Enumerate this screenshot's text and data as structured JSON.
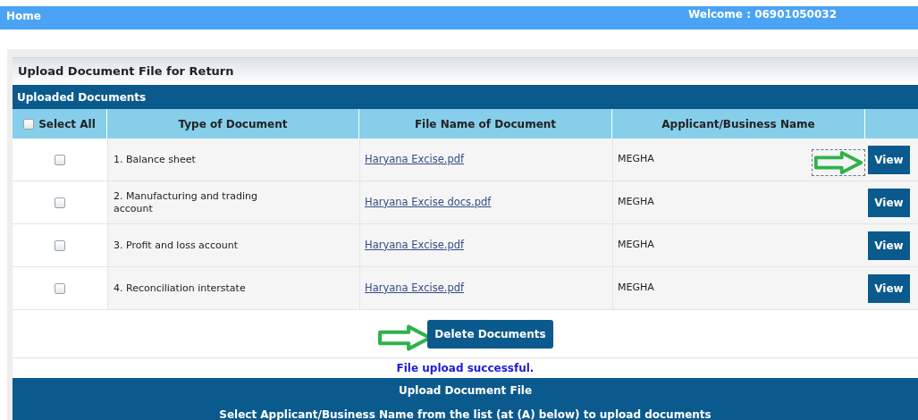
{
  "top_bar": {
    "home": "Home",
    "welcome": "Welcome : 06901050032"
  },
  "panel": {
    "title": "Upload Document File for Return",
    "section": "Uploaded Documents"
  },
  "table": {
    "select_all": {
      "label": "Select All",
      "checked": false
    },
    "columns": [
      "Type of Document",
      "File Name of Document",
      "Applicant/Business Name"
    ],
    "rows": [
      {
        "checked": false,
        "type": "1. Balance sheet",
        "file": "Haryana Excise.pdf",
        "applicant": "MEGHA",
        "action": "View",
        "annotated": true
      },
      {
        "checked": false,
        "type": "2. Manufacturing and trading account",
        "file": "Haryana Excise docs.pdf",
        "applicant": "MEGHA",
        "action": "View",
        "annotated": false
      },
      {
        "checked": false,
        "type": "3. Profit and loss account",
        "file": "Haryana Excise.pdf",
        "applicant": "MEGHA",
        "action": "View",
        "annotated": false
      },
      {
        "checked": false,
        "type": "4. Reconciliation interstate",
        "file": "Haryana Excise.pdf",
        "applicant": "MEGHA",
        "action": "View",
        "annotated": false
      }
    ]
  },
  "delete_button": {
    "label": "Delete Documents",
    "annotated": true
  },
  "message": "File upload successful.",
  "upload_section": {
    "title": "Upload Document File",
    "instruction": "Select Applicant/Business Name from the list (at (A) below) to upload documents"
  }
}
